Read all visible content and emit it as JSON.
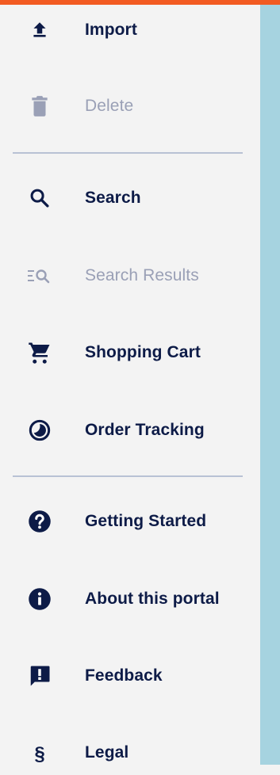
{
  "nav": {
    "items": [
      {
        "label": "Import",
        "icon": "upload-icon",
        "enabled": true
      },
      {
        "label": "Delete",
        "icon": "trash-icon",
        "enabled": false
      },
      {
        "label": "Search",
        "icon": "search-icon",
        "enabled": true
      },
      {
        "label": "Search Results",
        "icon": "search-results-icon",
        "enabled": false
      },
      {
        "label": "Shopping Cart",
        "icon": "cart-icon",
        "enabled": true
      },
      {
        "label": "Order Tracking",
        "icon": "tracking-icon",
        "enabled": true
      },
      {
        "label": "Getting Started",
        "icon": "help-icon",
        "enabled": true
      },
      {
        "label": "About this portal",
        "icon": "info-icon",
        "enabled": true
      },
      {
        "label": "Feedback",
        "icon": "feedback-icon",
        "enabled": true
      },
      {
        "label": "Legal",
        "icon": "section-icon",
        "enabled": true
      }
    ]
  },
  "colors": {
    "accent_bar": "#f25b22",
    "text": "#0d1b47",
    "disabled": "#9aa0b6",
    "side_panel": "#a6d3e0"
  }
}
